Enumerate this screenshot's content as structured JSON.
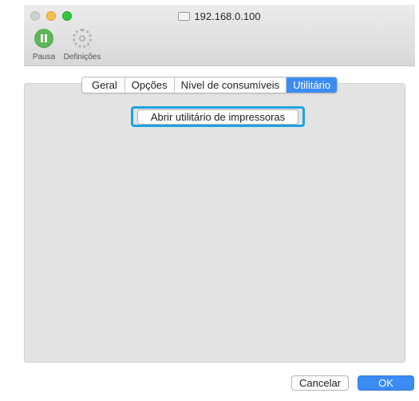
{
  "window": {
    "title": "192.168.0.100"
  },
  "toolbar": {
    "pause_label": "Pausa",
    "settings_label": "Definições"
  },
  "tabs": [
    {
      "label": "Geral",
      "active": false
    },
    {
      "label": "Opções",
      "active": false
    },
    {
      "label": "Nível de consumíveis",
      "active": false
    },
    {
      "label": "Utilitário",
      "active": true
    }
  ],
  "utility": {
    "open_button_label": "Abrir utilitário de impressoras"
  },
  "footer": {
    "cancel_label": "Cancelar",
    "ok_label": "OK"
  },
  "colors": {
    "accent": "#3b8cf4",
    "highlight": "#1aa4e0"
  }
}
